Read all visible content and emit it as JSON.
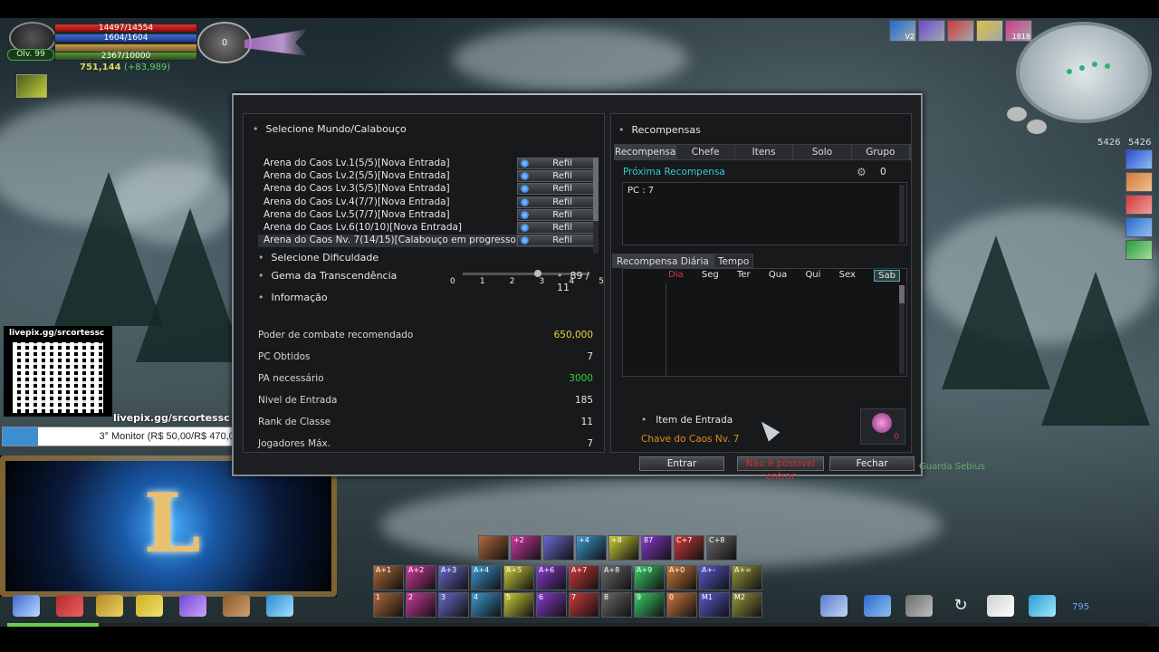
{
  "player": {
    "hp": "14497/14554",
    "mp": "1604/1604",
    "sp": "2367/10000",
    "level": "Olv. 99",
    "gold": "751,144",
    "gold_gain": "(+83,989)",
    "disc_value": "0"
  },
  "top_icons": [
    {
      "name": "buff-icon-1",
      "count": "V2",
      "color": "#1a6ad0"
    },
    {
      "name": "buff-icon-2",
      "count": "",
      "color": "#6a4ad0"
    },
    {
      "name": "buff-icon-3",
      "count": "",
      "color": "#d03a3a"
    },
    {
      "name": "buff-icon-4",
      "count": "",
      "color": "#e0c040"
    },
    {
      "name": "buff-icon-5",
      "count": "1818",
      "color": "#d03a8a"
    }
  ],
  "side_counts": {
    "left": "5426",
    "right": "5426"
  },
  "livepix": {
    "title": "livepix.gg/srcortessc",
    "url": "livepix.gg/srcortessc",
    "monitor": "3° Monitor (R$ 50,00/R$ 470,00)",
    "monitor_progress": 0.106
  },
  "dialog": {
    "world_title": "Selecione Mundo/Calabouço",
    "worlds": [
      {
        "name": "Arena do Caos Lv.1(5/5)[Nova Entrada]",
        "refil": "Refil"
      },
      {
        "name": "Arena do Caos Lv.2(5/5)[Nova Entrada]",
        "refil": "Refil"
      },
      {
        "name": "Arena do Caos Lv.3(5/5)[Nova Entrada]",
        "refil": "Refil"
      },
      {
        "name": "Arena do Caos Lv.4(7/7)[Nova Entrada]",
        "refil": "Refil"
      },
      {
        "name": "Arena do Caos Lv.5(7/7)[Nova Entrada]",
        "refil": "Refil"
      },
      {
        "name": "Arena do Caos Lv.6(10/10)[Nova Entrada]",
        "refil": "Refil"
      },
      {
        "name": "Arena do Caos Nv. 7(14/15)[Calabouço em progresso]",
        "refil": "Refil"
      }
    ],
    "difficulty_label": "Selecione Dificuldade",
    "difficulty_ticks": [
      "0",
      "1",
      "2",
      "3",
      "4",
      "5"
    ],
    "difficulty_value": 3,
    "gem_label": "Gema da Transcendência",
    "gem_value": "89 / 11",
    "info_title": "Informação",
    "info": [
      {
        "label": "Poder de combate recomendado",
        "value": "650,000",
        "color": "yellow"
      },
      {
        "label": "PC Obtidos",
        "value": "7",
        "color": ""
      },
      {
        "label": "PA necessário",
        "value": "3000",
        "color": "green"
      },
      {
        "label": "Nivel de Entrada",
        "value": "185",
        "color": ""
      },
      {
        "label": "Rank de Classe",
        "value": "11",
        "color": ""
      },
      {
        "label": "Jogadores Máx.",
        "value": "7",
        "color": ""
      }
    ],
    "rewards_title": "Recompensas",
    "reward_tabs": [
      "Recompensa",
      "Chefe",
      "Itens",
      "Solo",
      "Grupo"
    ],
    "next_reward_label": "Próxima Recompensa",
    "next_reward_count": "0",
    "pc_text": "PC : 7",
    "daily_tabs": [
      "Recompensa Diária",
      "Tempo"
    ],
    "days": [
      "Dia",
      "Seg",
      "Ter",
      "Qua",
      "Qui",
      "Sex",
      "Sab"
    ],
    "entry_title": "Item de Entrada",
    "entry_item": "Chave do Caos Nv. 7",
    "entry_count": "0",
    "buttons": {
      "enter": "Entrar",
      "middle": "Não é possível entrar",
      "close": "Fechar"
    }
  },
  "skills_row1": [
    "",
    "+2",
    "",
    "+4",
    "+8",
    "87",
    "C+7",
    "C+8"
  ],
  "skills_row2": [
    "A+1",
    "A+2",
    "A+3",
    "A+4",
    "A+5",
    "A+6",
    "A+7",
    "A+8",
    "A+9",
    "A+0",
    "A+-",
    "A+="
  ],
  "skills_row3": [
    "1",
    "2",
    "3",
    "4",
    "5",
    "6",
    "7",
    "8",
    "9",
    "0",
    "M1",
    "M2"
  ],
  "taskbar_value": "795",
  "npc_label": "Guarda Sebius"
}
